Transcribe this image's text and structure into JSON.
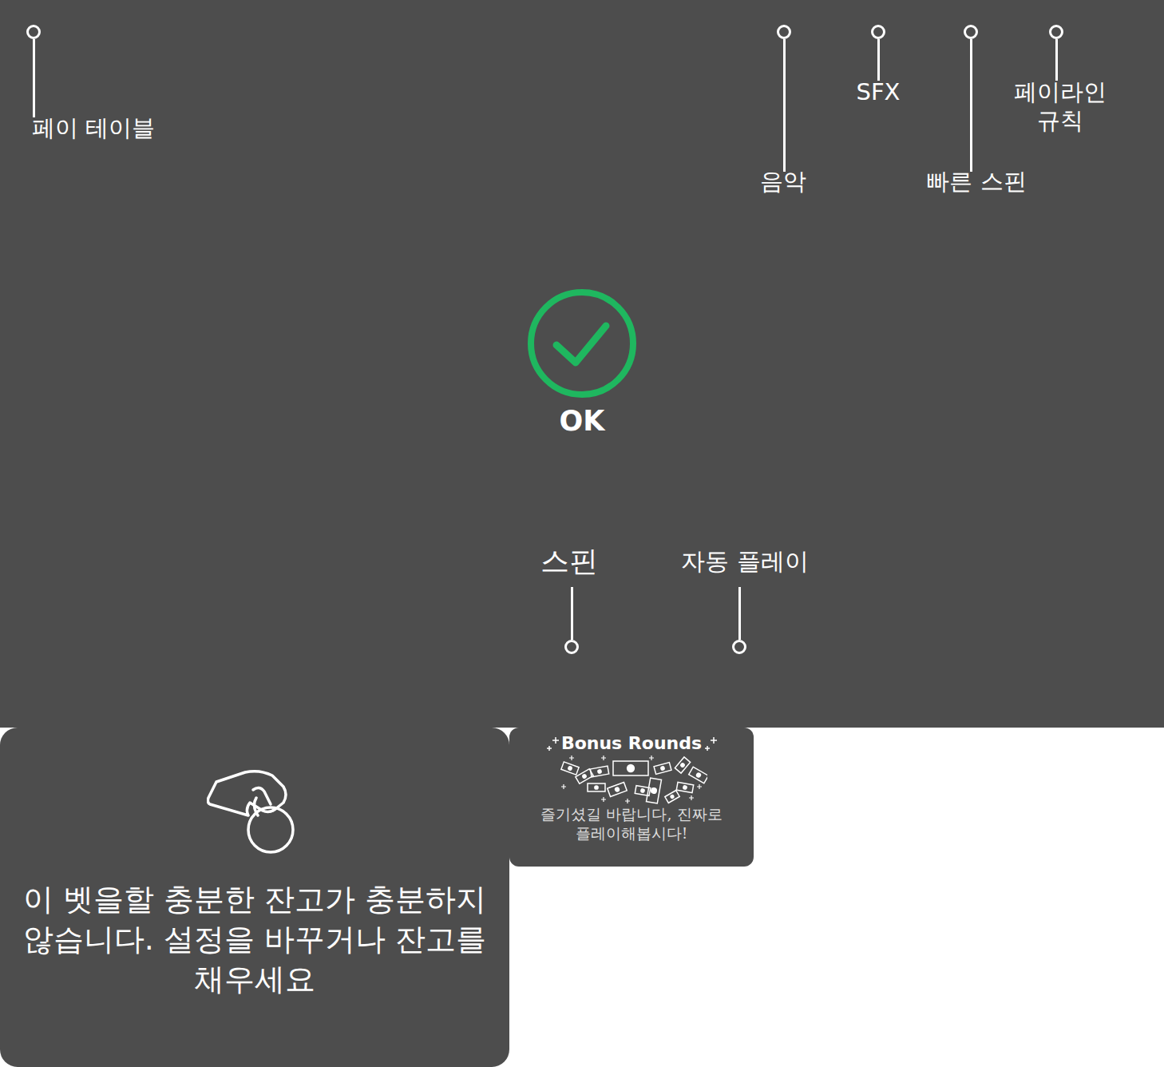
{
  "overlay": {
    "callouts": [
      {
        "label": "페이 테이블"
      },
      {
        "label": "음악"
      },
      {
        "label": "SFX"
      },
      {
        "label": "빠른 스핀"
      },
      {
        "label": "페이라인\n규칙"
      },
      {
        "label": "스핀"
      },
      {
        "label": "자동 플레이"
      }
    ],
    "ok_label": "OK"
  },
  "insufficient_card": {
    "message": "이 벳을할 충분한 잔고가 충분하지 않습니다. 설정을 바꾸거나 잔고를 채우세요"
  },
  "bonus_card": {
    "title": "Bonus Rounds",
    "text": "즐기셨길 바랍니다, 진짜로 플레이해봅시다!"
  }
}
